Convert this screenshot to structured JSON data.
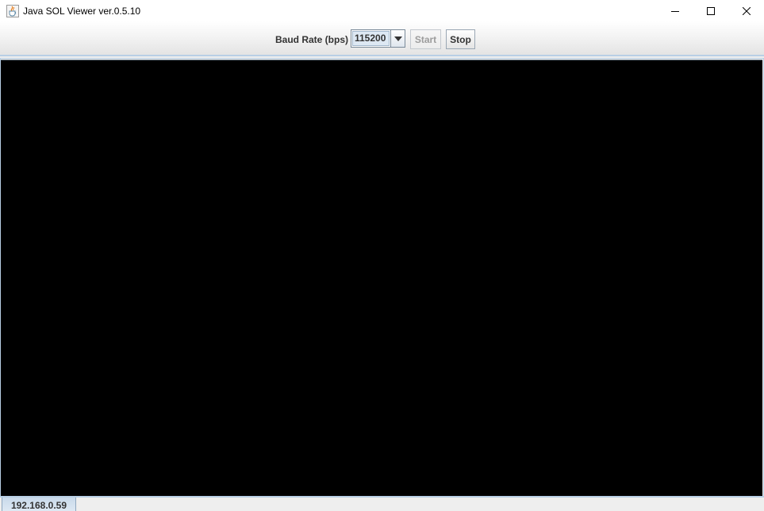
{
  "window": {
    "title": "Java SOL Viewer ver.0.5.10",
    "app_icon": "java-cup-icon",
    "controls": [
      "minimize-icon",
      "maximize-icon",
      "close-icon"
    ]
  },
  "toolbar": {
    "baud_label": "Baud Rate (bps)",
    "baud_value": "115200",
    "start_label": "Start",
    "stop_label": "Stop",
    "start_enabled": false,
    "stop_enabled": true
  },
  "display": {
    "background": "#000000"
  },
  "tabs": [
    {
      "label": "192.168.0.59",
      "selected": true
    }
  ],
  "colors": {
    "accent": "#b8cfe5",
    "combo_selection": "#dde8f3"
  }
}
